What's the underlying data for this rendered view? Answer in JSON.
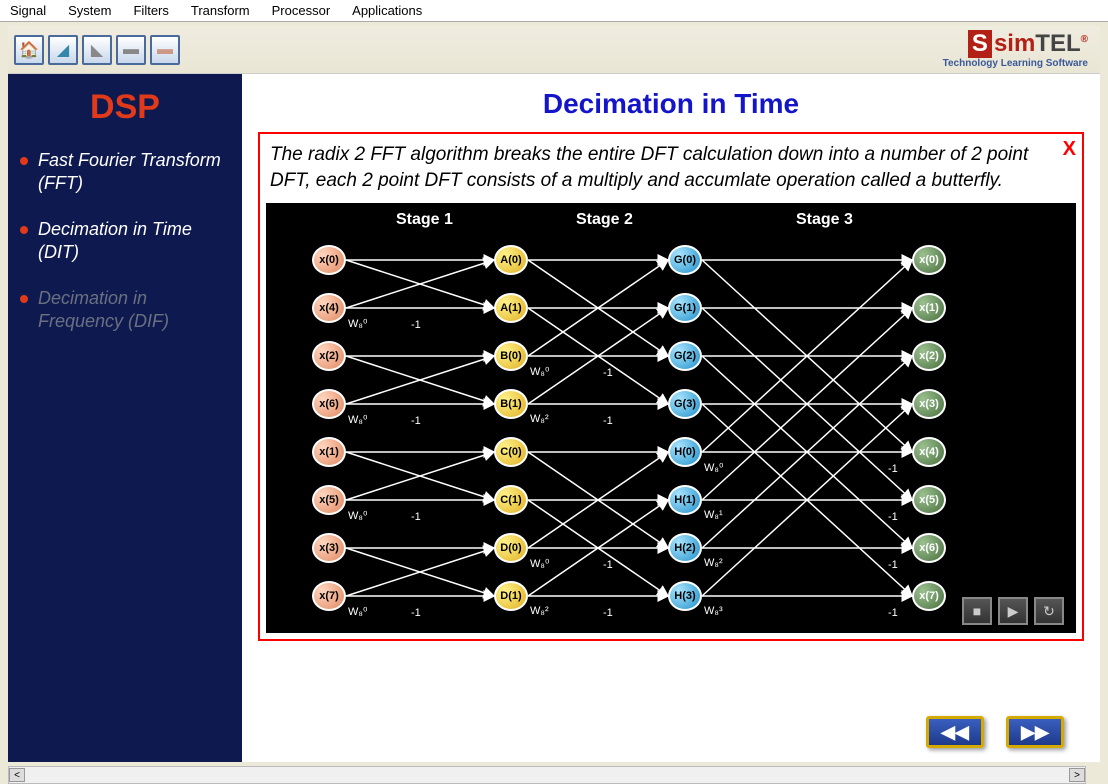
{
  "menubar": [
    "Signal",
    "System",
    "Filters",
    "Transform",
    "Processor",
    "Applications"
  ],
  "logo": {
    "brand_prefix": "sim",
    "brand_suffix": "TEL",
    "tagline": "Technology Learning Software",
    "reg": "®"
  },
  "sidebar": {
    "title": "DSP",
    "items": [
      {
        "label": "Fast Fourier Transform (FFT)",
        "state": "active"
      },
      {
        "label": "Decimation in Time (DIT)",
        "state": "active"
      },
      {
        "label": "Decimation in Frequency (DIF)",
        "state": "dim"
      }
    ]
  },
  "page": {
    "title": "Decimation in Time",
    "close": "X",
    "description": "The radix 2 FFT algorithm breaks the entire DFT calculation down into a number of 2 point DFT, each 2 point DFT consists of a multiply and accumlate operation called a butterfly."
  },
  "stages": [
    "Stage 1",
    "Stage 2",
    "Stage 3"
  ],
  "diagram": {
    "column_x": {
      "in": 46,
      "a": 228,
      "g": 402,
      "out": 646
    },
    "row_y": [
      42,
      90,
      138,
      186,
      234,
      282,
      330,
      378
    ],
    "inputs": [
      "x(0)",
      "x(4)",
      "x(2)",
      "x(6)",
      "x(1)",
      "x(5)",
      "x(3)",
      "x(7)"
    ],
    "col_a": [
      "A(0)",
      "A(1)",
      "B(0)",
      "B(1)",
      "C(0)",
      "C(1)",
      "D(0)",
      "D(1)"
    ],
    "col_g": [
      "G(0)",
      "G(1)",
      "G(2)",
      "G(3)",
      "H(0)",
      "H(1)",
      "H(2)",
      "H(3)"
    ],
    "outputs": [
      "x(0)",
      "x(1)",
      "x(2)",
      "x(3)",
      "x(4)",
      "x(5)",
      "x(6)",
      "x(7)"
    ],
    "w_labels_in": [
      {
        "text": "W₈⁰",
        "row": 1
      },
      {
        "text": "W₈⁰",
        "row": 3
      },
      {
        "text": "W₈⁰",
        "row": 5
      },
      {
        "text": "W₈⁰",
        "row": 7
      }
    ],
    "minus1_stage1_rows": [
      1,
      3,
      5,
      7
    ],
    "w_labels_a": [
      {
        "text": "W₈⁰",
        "row": 2
      },
      {
        "text": "W₈²",
        "row": 3
      },
      {
        "text": "W₈⁰",
        "row": 6
      },
      {
        "text": "W₈²",
        "row": 7
      }
    ],
    "minus1_stage2_rows": [
      2,
      3,
      6,
      7
    ],
    "w_labels_g": [
      {
        "text": "W₈⁰",
        "row": 4
      },
      {
        "text": "W₈¹",
        "row": 5
      },
      {
        "text": "W₈²",
        "row": 6
      },
      {
        "text": "W₈³",
        "row": 7
      }
    ],
    "minus1_stage3_rows": [
      4,
      5,
      6,
      7
    ]
  },
  "controls": {
    "stop": "■",
    "play": "▶",
    "reload": "↻"
  },
  "nav": {
    "prev": "◀◀",
    "next": "▶▶"
  },
  "scroll": {
    "left": "<",
    "right": ">"
  }
}
